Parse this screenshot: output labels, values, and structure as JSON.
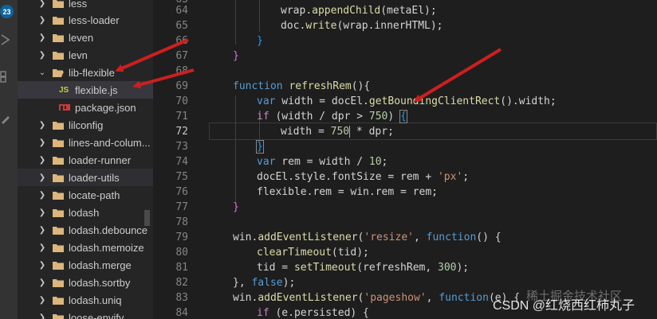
{
  "activity_bar": {
    "badge_count": "23"
  },
  "explorer": {
    "items": [
      {
        "label": "less",
        "type": "folder",
        "expanded": false
      },
      {
        "label": "less-loader",
        "type": "folder",
        "expanded": false
      },
      {
        "label": "leven",
        "type": "folder",
        "expanded": false
      },
      {
        "label": "levn",
        "type": "folder",
        "expanded": false
      },
      {
        "label": "lib-flexible",
        "type": "folder",
        "expanded": true
      },
      {
        "label": "flexible.js",
        "type": "file-js",
        "icon_text": "JS"
      },
      {
        "label": "package.json",
        "type": "file-json"
      },
      {
        "label": "lilconfig",
        "type": "folder",
        "expanded": false
      },
      {
        "label": "lines-and-colum...",
        "type": "folder",
        "expanded": false
      },
      {
        "label": "loader-runner",
        "type": "folder",
        "expanded": false
      },
      {
        "label": "loader-utils",
        "type": "folder",
        "expanded": false
      },
      {
        "label": "locate-path",
        "type": "folder",
        "expanded": false
      },
      {
        "label": "lodash",
        "type": "folder",
        "expanded": false
      },
      {
        "label": "lodash.debounce",
        "type": "folder",
        "expanded": false
      },
      {
        "label": "lodash.memoize",
        "type": "folder",
        "expanded": false
      },
      {
        "label": "lodash.merge",
        "type": "folder",
        "expanded": false
      },
      {
        "label": "lodash.sortby",
        "type": "folder",
        "expanded": false
      },
      {
        "label": "lodash.uniq",
        "type": "folder",
        "expanded": false
      },
      {
        "label": "loose-envify",
        "type": "folder",
        "expanded": false
      }
    ]
  },
  "editor": {
    "active_line": "72",
    "line_numbers": [
      "63",
      "64",
      "65",
      "66",
      "67",
      "68",
      "69",
      "70",
      "71",
      "72",
      "73",
      "74",
      "75",
      "76",
      "77",
      "78",
      "79",
      "80",
      "81",
      "82",
      "83",
      "84"
    ],
    "lines": {
      "l64_a": "wrap",
      "l64_b": ".",
      "l64_c": "appendChild",
      "l64_d": "(metaEl);",
      "l65_a": "doc",
      "l65_b": ".",
      "l65_c": "write",
      "l65_d": "(wrap.innerHTML);",
      "l66": "}",
      "l67": "}",
      "l69_kw": "function",
      "l69_fn": " refreshRem",
      "l69_rest": "(){",
      "l70_kw": "var",
      "l70_a": " width = docEl.",
      "l70_fn": "getBoundingClientRect",
      "l70_b": "().width;",
      "l71_kw": "if",
      "l71_a": " (width / dpr > ",
      "l71_num": "750",
      "l71_b": ") ",
      "l71_br": "{",
      "l72_a": "width = ",
      "l72_num": "750",
      "l72_b": " * dpr;",
      "l73": "}",
      "l74_kw": "var",
      "l74_a": " rem = width / ",
      "l74_num": "10",
      "l74_b": ";",
      "l75_a": "docEl.style.fontSize = rem + ",
      "l75_str": "'px'",
      "l75_b": ";",
      "l76": "flexible.rem = win.rem = rem;",
      "l77": "}",
      "l79_a": "win.",
      "l79_fn": "addEventListener",
      "l79_b": "(",
      "l79_str": "'resize'",
      "l79_c": ", ",
      "l79_kw": "function",
      "l79_d": "() {",
      "l80_fn": "clearTimeout",
      "l80_b": "(tid);",
      "l81_a": "tid = ",
      "l81_fn": "setTimeout",
      "l81_b": "(refreshRem, ",
      "l81_num": "300",
      "l81_c": ");",
      "l82_a": "}, ",
      "l82_kw": "false",
      "l82_b": ");",
      "l83_a": "win.",
      "l83_fn": "addEventListener",
      "l83_b": "(",
      "l83_str": "'pageshow'",
      "l83_c": ", ",
      "l83_kw": "function",
      "l83_d": "(e) {",
      "l84_kw": "if",
      "l84_a": " (e.persisted) {"
    }
  },
  "watermark": {
    "text": "CSDN @红烧西红柿丸子",
    "faint": "稀土掘金技术社区"
  },
  "colors": {
    "annotation_arrow": "#cc1f1f",
    "selection": "#37373d",
    "accent": "#0e639c"
  }
}
